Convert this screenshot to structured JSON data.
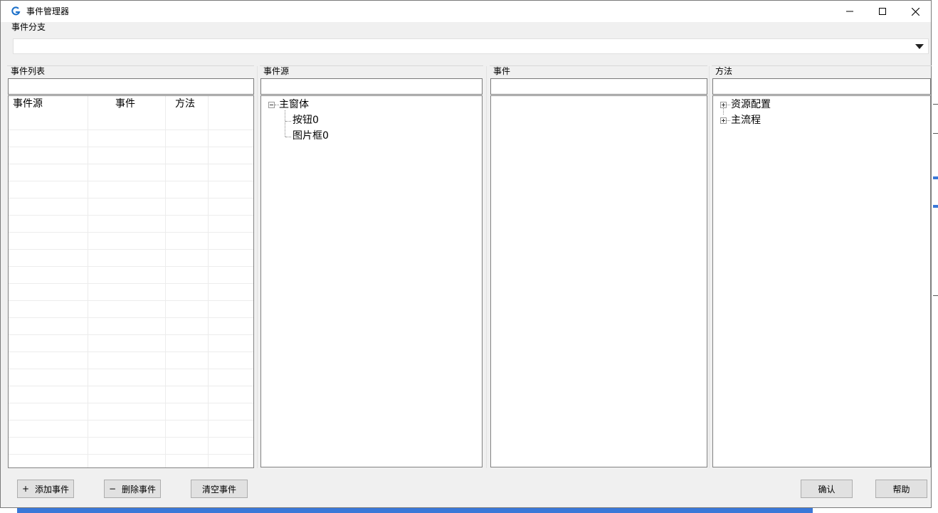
{
  "window": {
    "title": "事件管理器"
  },
  "branch": {
    "label": "事件分支",
    "value": ""
  },
  "event_list": {
    "label": "事件列表",
    "search_value": "",
    "columns": [
      "事件源",
      "事件",
      "方法"
    ],
    "rows": []
  },
  "event_source": {
    "label": "事件源",
    "search_value": "",
    "tree": {
      "root": "主窗体",
      "children": [
        "按钮0",
        "图片框0"
      ]
    }
  },
  "events": {
    "label": "事件",
    "search_value": ""
  },
  "methods": {
    "label": "方法",
    "search_value": "",
    "tree": [
      "资源配置",
      "主流程"
    ]
  },
  "buttons": {
    "add": {
      "prefix": "+",
      "label": "添加事件"
    },
    "delete": {
      "prefix": "−",
      "label": "删除事件"
    },
    "clear": {
      "label": "清空事件"
    },
    "confirm": {
      "label": "确认"
    },
    "help": {
      "label": "帮助"
    }
  },
  "colors": {
    "accent": "#3a78d8",
    "icon": "#1a6fc9"
  }
}
